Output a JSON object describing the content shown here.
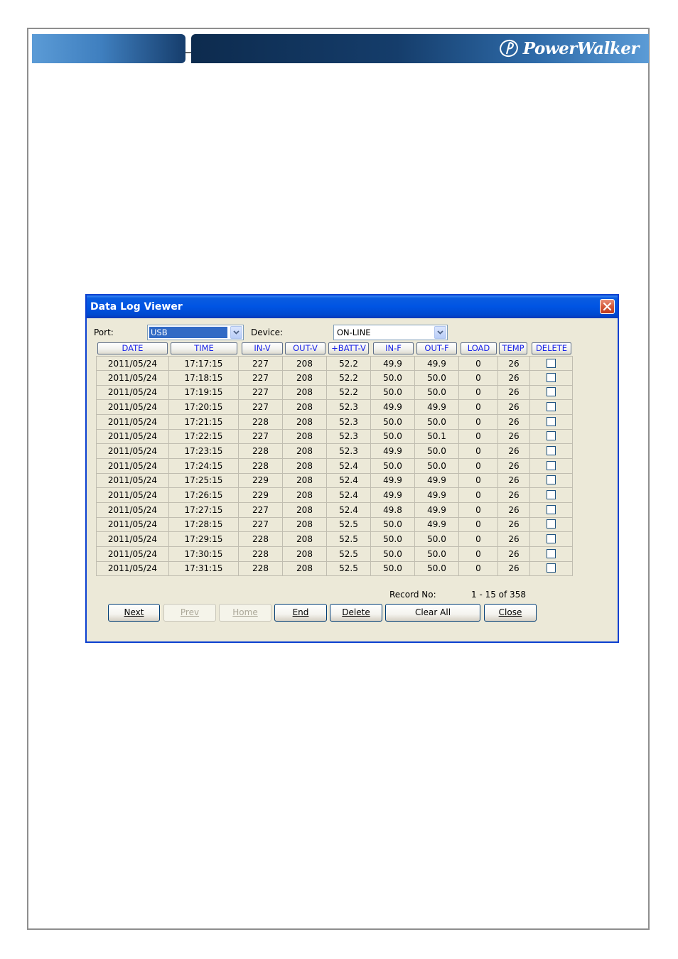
{
  "brand": {
    "name": "PowerWalker"
  },
  "dialog": {
    "title": "Data Log Viewer",
    "port_label": "Port:",
    "port_value": "USB",
    "device_label": "Device:",
    "device_value": "ON-LINE",
    "columns": [
      "DATE",
      "TIME",
      "IN-V",
      "OUT-V",
      "+BATT-V",
      "IN-F",
      "OUT-F",
      "LOAD",
      "TEMP",
      "DELETE"
    ],
    "rows": [
      [
        "2011/05/24",
        "17:17:15",
        "227",
        "208",
        "52.2",
        "49.9",
        "49.9",
        "0",
        "26"
      ],
      [
        "2011/05/24",
        "17:18:15",
        "227",
        "208",
        "52.2",
        "50.0",
        "50.0",
        "0",
        "26"
      ],
      [
        "2011/05/24",
        "17:19:15",
        "227",
        "208",
        "52.2",
        "50.0",
        "50.0",
        "0",
        "26"
      ],
      [
        "2011/05/24",
        "17:20:15",
        "227",
        "208",
        "52.3",
        "49.9",
        "49.9",
        "0",
        "26"
      ],
      [
        "2011/05/24",
        "17:21:15",
        "228",
        "208",
        "52.3",
        "50.0",
        "50.0",
        "0",
        "26"
      ],
      [
        "2011/05/24",
        "17:22:15",
        "227",
        "208",
        "52.3",
        "50.0",
        "50.1",
        "0",
        "26"
      ],
      [
        "2011/05/24",
        "17:23:15",
        "228",
        "208",
        "52.3",
        "49.9",
        "50.0",
        "0",
        "26"
      ],
      [
        "2011/05/24",
        "17:24:15",
        "228",
        "208",
        "52.4",
        "50.0",
        "50.0",
        "0",
        "26"
      ],
      [
        "2011/05/24",
        "17:25:15",
        "229",
        "208",
        "52.4",
        "49.9",
        "49.9",
        "0",
        "26"
      ],
      [
        "2011/05/24",
        "17:26:15",
        "229",
        "208",
        "52.4",
        "49.9",
        "49.9",
        "0",
        "26"
      ],
      [
        "2011/05/24",
        "17:27:15",
        "227",
        "208",
        "52.4",
        "49.8",
        "49.9",
        "0",
        "26"
      ],
      [
        "2011/05/24",
        "17:28:15",
        "227",
        "208",
        "52.5",
        "50.0",
        "49.9",
        "0",
        "26"
      ],
      [
        "2011/05/24",
        "17:29:15",
        "228",
        "208",
        "52.5",
        "50.0",
        "50.0",
        "0",
        "26"
      ],
      [
        "2011/05/24",
        "17:30:15",
        "228",
        "208",
        "52.5",
        "50.0",
        "50.0",
        "0",
        "26"
      ],
      [
        "2011/05/24",
        "17:31:15",
        "228",
        "208",
        "52.5",
        "50.0",
        "50.0",
        "0",
        "26"
      ]
    ],
    "record_label": "Record No:",
    "record_value": "1 - 15 of 358",
    "buttons": {
      "next": "Next",
      "prev": "Prev",
      "home": "Home",
      "end": "End",
      "delete": "Delete",
      "clear_all": "Clear All",
      "close": "Close"
    }
  }
}
